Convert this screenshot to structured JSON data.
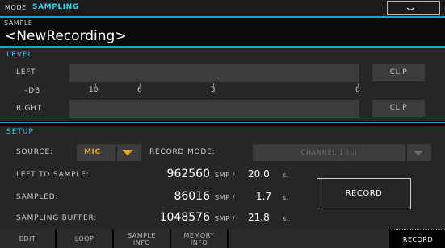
{
  "topbar": {
    "mode_label": "MODE",
    "mode_value": "SAMPLING"
  },
  "sample": {
    "label": "SAMPLE",
    "name": "<NewRecording>"
  },
  "level": {
    "title": "LEVEL",
    "left_label": "LEFT",
    "right_label": "RIGHT",
    "db_label": "–dB",
    "clip_label": "CLIP",
    "ticks": [
      "10",
      "6",
      "3",
      "0"
    ]
  },
  "setup": {
    "title": "SETUP",
    "source_label": "SOURCE:",
    "source_value": "MIC",
    "record_mode_label": "RECORD MODE:",
    "record_mode_value": "CHANNEL 1 (L)",
    "rows": [
      {
        "label": "LEFT TO SAMPLE:",
        "value": "962560",
        "unit": "SMP /",
        "seconds": "20.0",
        "sec_unit": "s."
      },
      {
        "label": "SAMPLED:",
        "value": "86016",
        "unit": "SMP /",
        "seconds": "1.7",
        "sec_unit": "s."
      },
      {
        "label": "SAMPLING BUFFER:",
        "value": "1048576",
        "unit": "SMP /",
        "seconds": "21.8",
        "sec_unit": "s."
      }
    ],
    "record_button": "RECORD"
  },
  "tabs": [
    {
      "label": "EDIT"
    },
    {
      "label": "LOOP"
    },
    {
      "label": "SAMPLE\nINFO"
    },
    {
      "label": "MEMORY\nINFO"
    },
    {
      "label": "RECORD"
    }
  ],
  "colors": {
    "accent": "#2fd0f0",
    "source_value": "#e8a51c",
    "divider": "#1aa3d3"
  }
}
